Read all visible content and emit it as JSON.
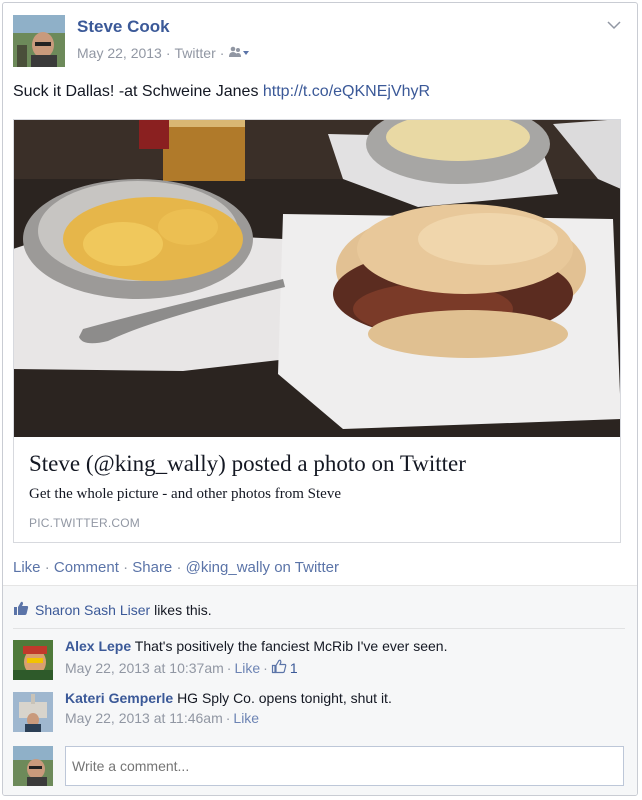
{
  "post": {
    "author": "Steve Cook",
    "date": "May 22, 2013",
    "source": "Twitter",
    "privacy_icon": "friends-icon",
    "text": "Suck it Dallas! -at Schweine Janes ",
    "link": "http://t.co/eQKNEjVhyR"
  },
  "link_preview": {
    "title": "Steve (@king_wally) posted a photo on Twitter",
    "description": "Get the whole picture - and other photos from Steve",
    "domain": "PIC.TWITTER.COM"
  },
  "actions": {
    "like": "Like",
    "comment": "Comment",
    "share": "Share",
    "via": "@king_wally on Twitter"
  },
  "likes": {
    "who": "Sharon Sash Liser",
    "suffix": "likes this."
  },
  "comments": [
    {
      "author": "Alex Lepe",
      "text": "That's positively the fanciest McRib I've ever seen.",
      "time": "May 22, 2013 at 10:37am",
      "like_label": "Like",
      "like_count": "1"
    },
    {
      "author": "Kateri Gemperle",
      "text": "HG Sply Co. opens tonight, shut it.",
      "time": "May 22, 2013 at 11:46am",
      "like_label": "Like"
    }
  ],
  "composer": {
    "placeholder": "Write a comment..."
  },
  "colors": {
    "link_blue": "#3b5998",
    "meta_gray": "#9197a3"
  }
}
